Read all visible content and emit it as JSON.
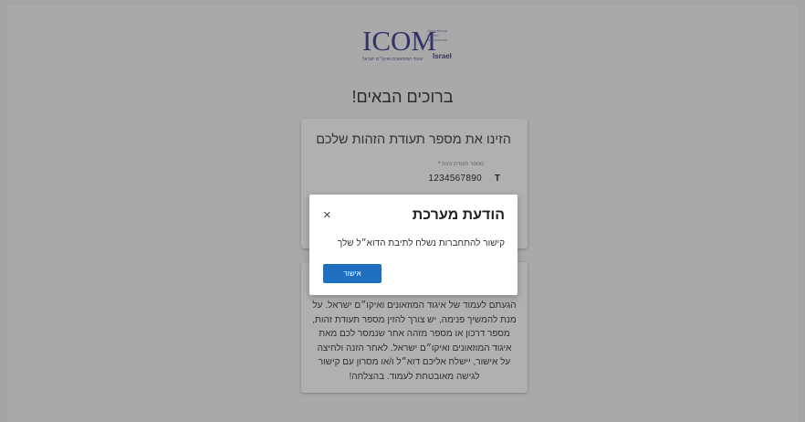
{
  "logo": {
    "main": "ICOM",
    "side_lines": [
      "International",
      "council",
      "of museums"
    ],
    "israel": "Israel",
    "subtitle": "איגוד המוזיאונים ואיקו״ם ישראל"
  },
  "welcome": "ברוכים הבאים!",
  "id_card": {
    "title": "הזינו את מספר תעודת הזהות שלכם",
    "field_label": "מספר תעודת זהות",
    "required_mark": "*",
    "value": "1234567890",
    "icon_glyph": "T"
  },
  "info_card": {
    "text": "הגעתם לעמוד של איגוד המוזאונים ואיקו״ם ישראל. על מנת להמשיך פנימה, יש צורך להזין מספר תעודת זהות, מספר דרכון או מספר מזהה אחר שנמסר לכם מאת איגוד המוזאונים ואיקו״ם ישראל. לאחר הזנה ולחיצה על אישור, יישלח אליכם דוא״ל ו/או מסרון עם קישור לגישה מאובטחת לעמוד. בהצלחה!"
  },
  "modal": {
    "title": "הודעת מערכת",
    "close_glyph": "×",
    "message": "קישור להתחברות נשלח לתיבת הדוא״ל שלך",
    "confirm_label": "אישור"
  },
  "colors": {
    "overlay": "#a4a4a4",
    "primary_button": "#1e6fbf",
    "logo_navy": "#323268"
  }
}
